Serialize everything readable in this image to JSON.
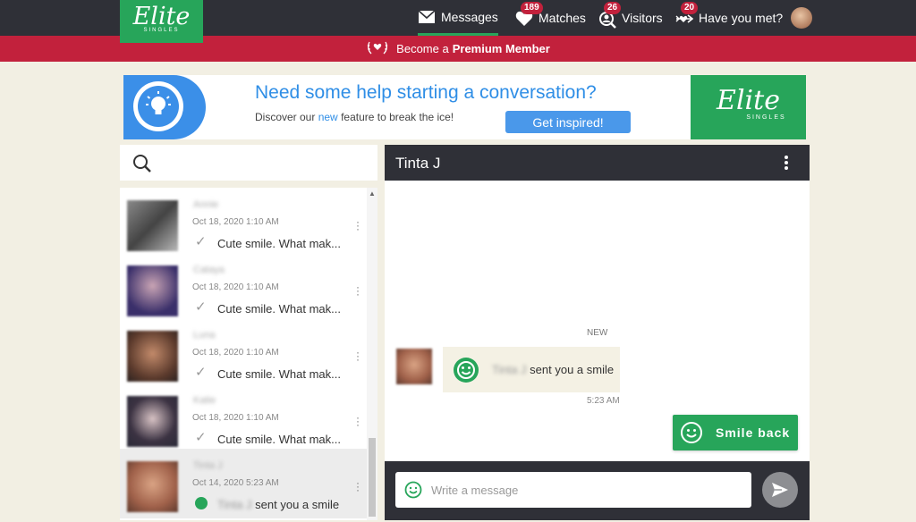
{
  "brand": {
    "logo_text": "Elite",
    "logo_sub": "SINGLES",
    "green": "#27a55a",
    "red": "#c2213c",
    "dark": "#2f3037"
  },
  "nav": {
    "messages": {
      "label": "Messages",
      "icon": "envelope-icon"
    },
    "matches": {
      "label": "Matches",
      "count": "189",
      "icon": "heart-icon"
    },
    "visitors": {
      "label": "Visitors",
      "count": "26",
      "icon": "visitor-icon"
    },
    "have_you_met": {
      "label": "Have you met?",
      "count": "20",
      "icon": "cupid-arrow-icon"
    }
  },
  "premium": {
    "prefix": "Become a",
    "bold": "Premium Member"
  },
  "banner": {
    "title": "Need some help starting a conversation?",
    "sub_before": "Discover our",
    "sub_new": "new",
    "sub_after": "feature to break the ice!",
    "button": "Get inspired!"
  },
  "search": {
    "placeholder": ""
  },
  "conversations": [
    {
      "name": "Annie",
      "date": "Oct 18, 2020 1:10 AM",
      "preview": "Cute smile. What mak..."
    },
    {
      "name": "Cataya",
      "date": "Oct 18, 2020 1:10 AM",
      "preview": "Cute smile. What mak..."
    },
    {
      "name": "Luna",
      "date": "Oct 18, 2020 1:10 AM",
      "preview": "Cute smile. What mak..."
    },
    {
      "name": "Katie",
      "date": "Oct 18, 2020 1:10 AM",
      "preview": "Cute smile. What mak..."
    },
    {
      "name": "Tinta J",
      "date": "Oct 14, 2020 5:23 AM",
      "preview_name": "Tinta J",
      "preview": "sent you a smile"
    }
  ],
  "chat": {
    "name": "Tinta J",
    "new_label": "NEW",
    "message_sender": "Tinta J",
    "message_text": "sent you a smile",
    "message_time": "5:23 AM",
    "smile_back": "Smile back",
    "input_placeholder": "Write a message"
  }
}
